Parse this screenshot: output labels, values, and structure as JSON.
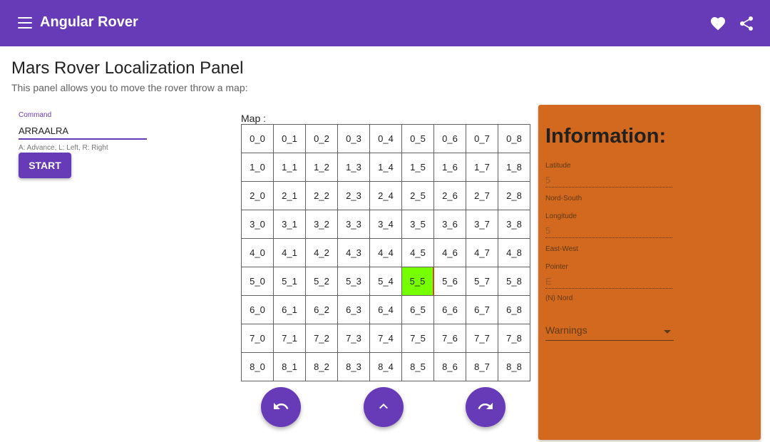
{
  "toolbar": {
    "title": "Angular Rover",
    "menu_icon": "menu-icon",
    "favorite_icon": "heart-icon",
    "share_icon": "share-icon"
  },
  "page": {
    "title": "Mars Rover Localization Panel",
    "subtitle": "This panel allows you to move the rover throw a map:"
  },
  "command": {
    "label": "Command",
    "value": "ARRAALRA",
    "hint": "A: Advance, L: Left, R: Right",
    "start_label": "START"
  },
  "map": {
    "label": "Map :",
    "rows": [
      [
        "0_0",
        "0_1",
        "0_2",
        "0_3",
        "0_4",
        "0_5",
        "0_6",
        "0_7",
        "0_8"
      ],
      [
        "1_0",
        "1_1",
        "1_2",
        "1_3",
        "1_4",
        "1_5",
        "1_6",
        "1_7",
        "1_8"
      ],
      [
        "2_0",
        "2_1",
        "2_2",
        "2_3",
        "2_4",
        "2_5",
        "2_6",
        "2_7",
        "2_8"
      ],
      [
        "3_0",
        "3_1",
        "3_2",
        "3_3",
        "3_4",
        "3_5",
        "3_6",
        "3_7",
        "3_8"
      ],
      [
        "4_0",
        "4_1",
        "4_2",
        "4_3",
        "4_4",
        "4_5",
        "4_6",
        "4_7",
        "4_8"
      ],
      [
        "5_0",
        "5_1",
        "5_2",
        "5_3",
        "5_4",
        "5_5",
        "5_6",
        "5_7",
        "5_8"
      ],
      [
        "6_0",
        "6_1",
        "6_2",
        "6_3",
        "6_4",
        "6_5",
        "6_6",
        "6_7",
        "6_8"
      ],
      [
        "7_0",
        "7_1",
        "7_2",
        "7_3",
        "7_4",
        "7_5",
        "7_6",
        "7_7",
        "7_8"
      ],
      [
        "8_0",
        "8_1",
        "8_2",
        "8_3",
        "8_4",
        "8_5",
        "8_6",
        "8_7",
        "8_8"
      ]
    ],
    "rover_cell": "5_5",
    "rover_color": "#76ff03",
    "controls": [
      "rotate-left-icon",
      "advance-icon",
      "rotate-right-icon"
    ]
  },
  "info": {
    "title": "Information:",
    "latitude": {
      "label": "Latitude",
      "value": "5",
      "hint": "Nord-South"
    },
    "longitude": {
      "label": "Longitude",
      "value": "5",
      "hint": "East-West"
    },
    "pointer": {
      "label": "Pointer",
      "value": "E",
      "hint": "(N) Nord"
    },
    "warnings": {
      "label": "Warnings"
    }
  },
  "colors": {
    "primary": "#673ab7",
    "info_panel": "#d2691e"
  }
}
